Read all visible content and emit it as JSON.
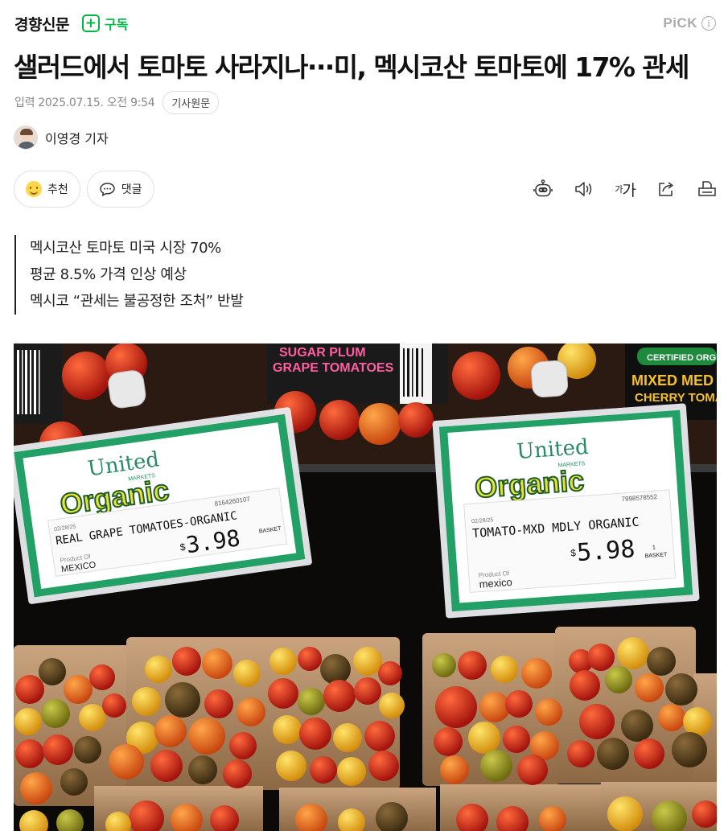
{
  "header": {
    "press_name": "경향신문",
    "subscribe_plus": "+",
    "subscribe_label": "구독",
    "pick_label": "PiCK",
    "info_icon": "i"
  },
  "article": {
    "headline": "샐러드에서 토마토 사라지나···미, 멕시코산 토마토에 17% 관세",
    "date": "입력 2025.07.15. 오전 9:54",
    "original_button": "기사원문",
    "author": "이영경 기자",
    "summary": [
      "멕시코산 토마토 미국 시장 70%",
      "평균 8.5% 가격 인상 예상",
      "멕시코 “관세는 불공정한 조처” 반발"
    ]
  },
  "actions": {
    "recommend_label": "추천",
    "comment_label": "댓글",
    "fontsize_small": "가",
    "fontsize_large": "가",
    "icons": [
      "robot-summary-icon",
      "speaker-icon",
      "font-size-icon",
      "share-icon",
      "print-icon"
    ]
  },
  "photo": {
    "top_packages": [
      "SUGAR PLUM",
      "GRAPE TOMATOES",
      "CERTIFIED ORG",
      "MIXED MED",
      "CHERRY TOMA"
    ],
    "tag_left": {
      "brand": "United",
      "brand_sub": "MARKETS",
      "organic": "Organic",
      "code": "8164260107",
      "date": "02/28/25",
      "item": "REAL GRAPE TOMATOES-ORGANIC",
      "price": "3.98",
      "unit": "BASKET",
      "origin_label": "Product Of",
      "origin": "MEXICO"
    },
    "tag_right": {
      "brand": "United",
      "brand_sub": "MARKETS",
      "organic": "Organic",
      "code": "7998578552",
      "date": "02/28/25",
      "item": "TOMATO-MXD MDLY ORGANIC",
      "price": "5.98",
      "qty": "1",
      "unit": "BASKET",
      "origin_label": "Product Of",
      "origin": "mexico"
    },
    "colors": {
      "tag_green": "#1e9a5e",
      "organic_yellow": "#e8e23a",
      "tomato_red": "#c8261c"
    }
  }
}
